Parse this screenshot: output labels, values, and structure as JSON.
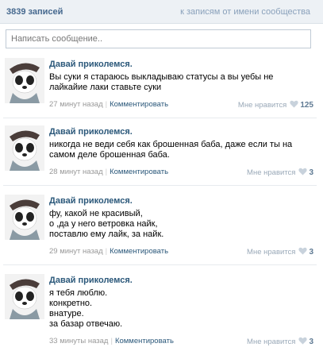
{
  "header": {
    "count_label": "3839 записей",
    "owner_link": "к записям от имени сообщества"
  },
  "composer": {
    "placeholder": "Написать сообщение.."
  },
  "posts": [
    {
      "author": "Давай приколемся.",
      "text": "Вы суки я стараюсь выкладываю статусы а вы уебы не лайкайие лаки ставьте суки",
      "time": "27 минут назад",
      "comment_label": "Комментировать",
      "like_label": "Мне нравится",
      "likes": "125"
    },
    {
      "author": "Давай приколемся.",
      "text": "никогда не веди себя как брошенная баба, даже если ты на самом деле брошенная баба.",
      "time": "28 минут назад",
      "comment_label": "Комментировать",
      "like_label": "Мне нравится",
      "likes": "3"
    },
    {
      "author": "Давай приколемся.",
      "text": "фу, какой не красивый,\nо ,да у него ветровка найк,\nпоставлю ему лайк, за найк.",
      "time": "29 минут назад",
      "comment_label": "Комментировать",
      "like_label": "Мне нравится",
      "likes": "3"
    },
    {
      "author": "Давай приколемся.",
      "text": "я тебя люблю.\nконкретно.\nвнатуре.\nза базар отвечаю.",
      "time": "33 минуты назад",
      "comment_label": "Комментировать",
      "like_label": "Мне нравится",
      "likes": "3"
    }
  ],
  "colors": {
    "link": "#2b587a",
    "header_bg": "#edf1f5",
    "muted": "#999999"
  }
}
